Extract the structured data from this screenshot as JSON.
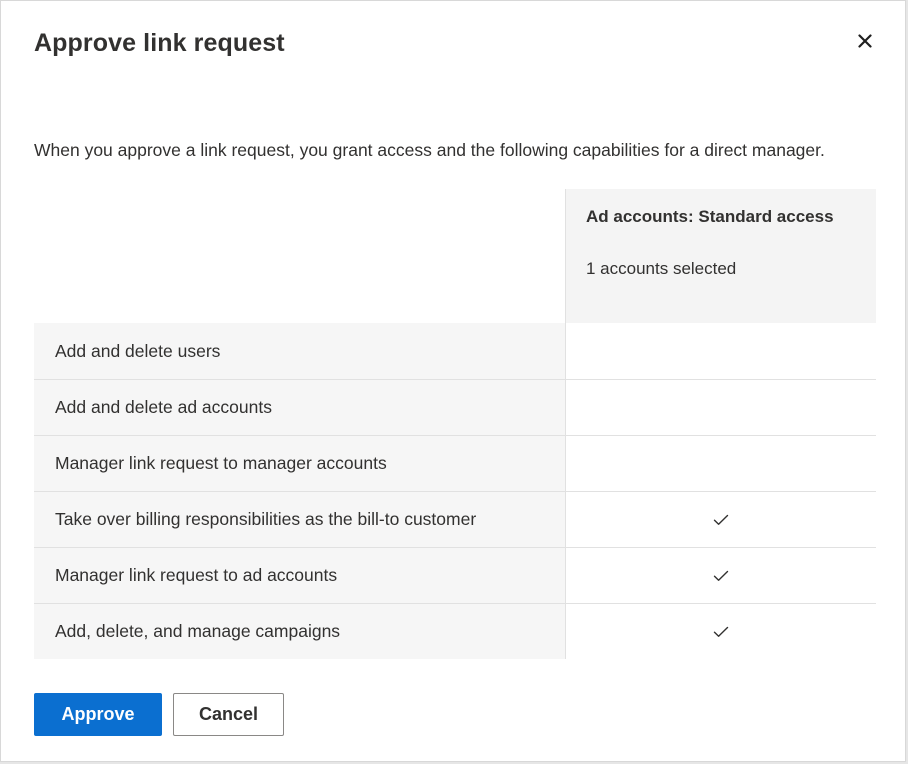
{
  "dialog": {
    "title": "Approve link request",
    "close_icon": "close-icon",
    "intro": "When you approve a link request, you grant access and the following capabilities for a direct manager."
  },
  "table": {
    "column_title": "Ad accounts: Standard access",
    "column_subtitle": "1 accounts selected",
    "rows": [
      {
        "label": "Add and delete users",
        "checked": false
      },
      {
        "label": "Add and delete ad accounts",
        "checked": false
      },
      {
        "label": "Manager link request to manager accounts",
        "checked": false
      },
      {
        "label": "Take over billing responsibilities as the bill-to customer",
        "checked": true
      },
      {
        "label": "Manager link request to ad accounts",
        "checked": true
      },
      {
        "label": "Add, delete, and manage campaigns",
        "checked": true
      }
    ]
  },
  "actions": {
    "approve_label": "Approve",
    "cancel_label": "Cancel"
  },
  "colors": {
    "primary": "#0b6fd0",
    "row_background": "#f6f6f6",
    "header_background": "#f4f4f4",
    "divider": "#e1e1e1"
  }
}
